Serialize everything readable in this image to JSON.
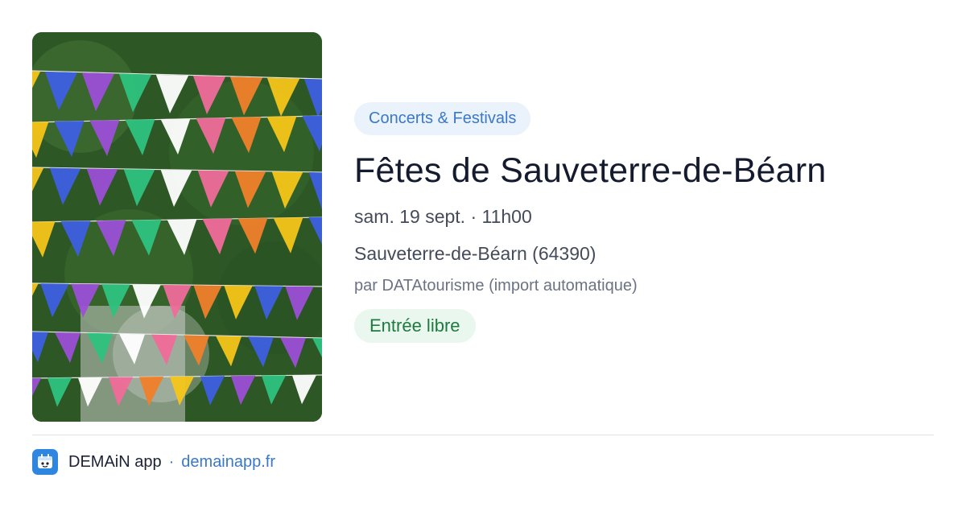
{
  "event": {
    "category": "Concerts & Festivals",
    "title": "Fêtes de Sauveterre-de-Béarn",
    "datetime": "sam. 19 sept. · 11h00",
    "location": "Sauveterre-de-Béarn (64390)",
    "organizer": "par DATAtourisme (import automatique)",
    "price": "Entrée libre"
  },
  "footer": {
    "app_name": "DEMAiN app",
    "separator": "·",
    "url": "demainapp.fr"
  },
  "image": {
    "flag_colors": [
      "#f5c518",
      "#f06b9a",
      "#2ec27e",
      "#3d5fe0",
      "#f07f2a",
      "#ffffff",
      "#9b4fd6"
    ]
  },
  "colors": {
    "category_badge_bg": "#eaf2fb",
    "category_badge_text": "#3a78c9",
    "price_badge_bg": "#e9f7ee",
    "price_badge_text": "#1f7a3f",
    "link": "#3a78c9",
    "app_logo": "#2e86e0"
  },
  "icons": {
    "app_logo": "demain-app-logo-icon"
  }
}
